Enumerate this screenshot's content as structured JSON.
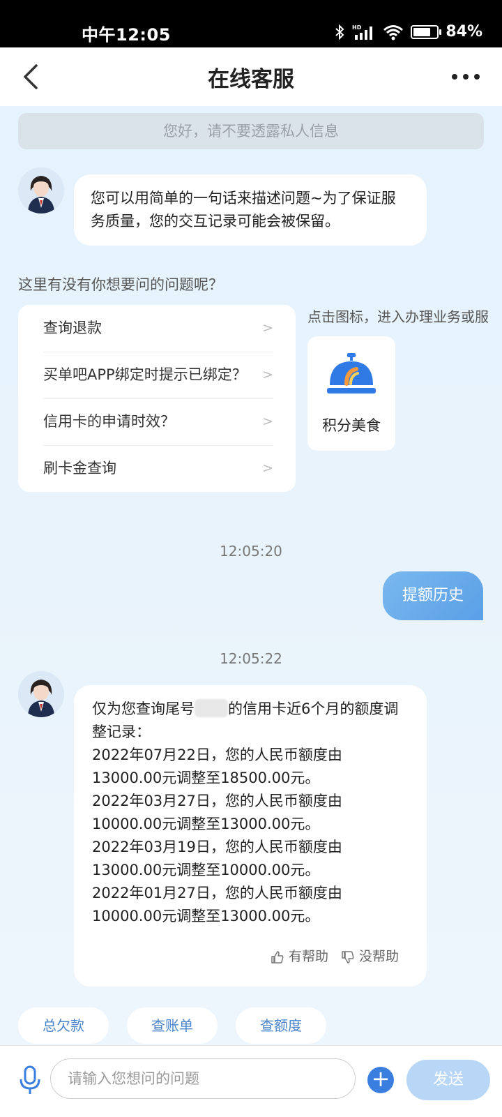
{
  "status_bar": {
    "time": "中午12:05",
    "battery": "84%",
    "battery_level": 0.84,
    "icons": [
      "bluetooth-icon",
      "hd-signal-icon",
      "wifi-icon",
      "battery-icon"
    ]
  },
  "header": {
    "title": "在线客服",
    "back_icon": "chevron-left-icon",
    "more_icon": "more-dots-icon"
  },
  "chat": {
    "notice": "您好，请不要透露私人信息",
    "greeting": "您可以用简单的一句话来描述问题~为了保证服务质量，您的交互记录可能会被保留。",
    "ask_title": "这里有没有你想要问的问题呢？",
    "faq": [
      {
        "label": "查询退款",
        "chevron": ">"
      },
      {
        "label": "买单吧APP绑定时提示已绑定？",
        "chevron": ">"
      },
      {
        "label": "信用卡的申请时效？",
        "chevron": ">"
      },
      {
        "label": "刷卡金查询",
        "chevron": ">"
      }
    ],
    "service_hint": "点击图标，进入办理业务或服",
    "service": {
      "label": "积分美食",
      "icon": "service-bell-icon"
    },
    "time1": "12:05:20",
    "user_message": "提额历史",
    "time2": "12:05:22",
    "reply": {
      "line_pre": "仅为您查询尾号",
      "line_post": "的信用卡近6个月的额度调整记录：",
      "records": [
        "2022年07月22日，您的人民币额度由13000.00元调整至18500.00元。",
        "2022年03月27日，您的人民币额度由10000.00元调整至13000.00元。",
        "2022年03月19日，您的人民币额度由13000.00元调整至10000.00元。",
        "2022年01月27日，您的人民币额度由10000.00元调整至13000.00元。"
      ],
      "helpful": "有帮助",
      "not_helpful": "没帮助"
    },
    "quick_replies": [
      "总欠款",
      "查账单",
      "查额度"
    ]
  },
  "input_bar": {
    "placeholder": "请输入您想问的问题",
    "value": "",
    "send": "发送",
    "plus": "+"
  }
}
